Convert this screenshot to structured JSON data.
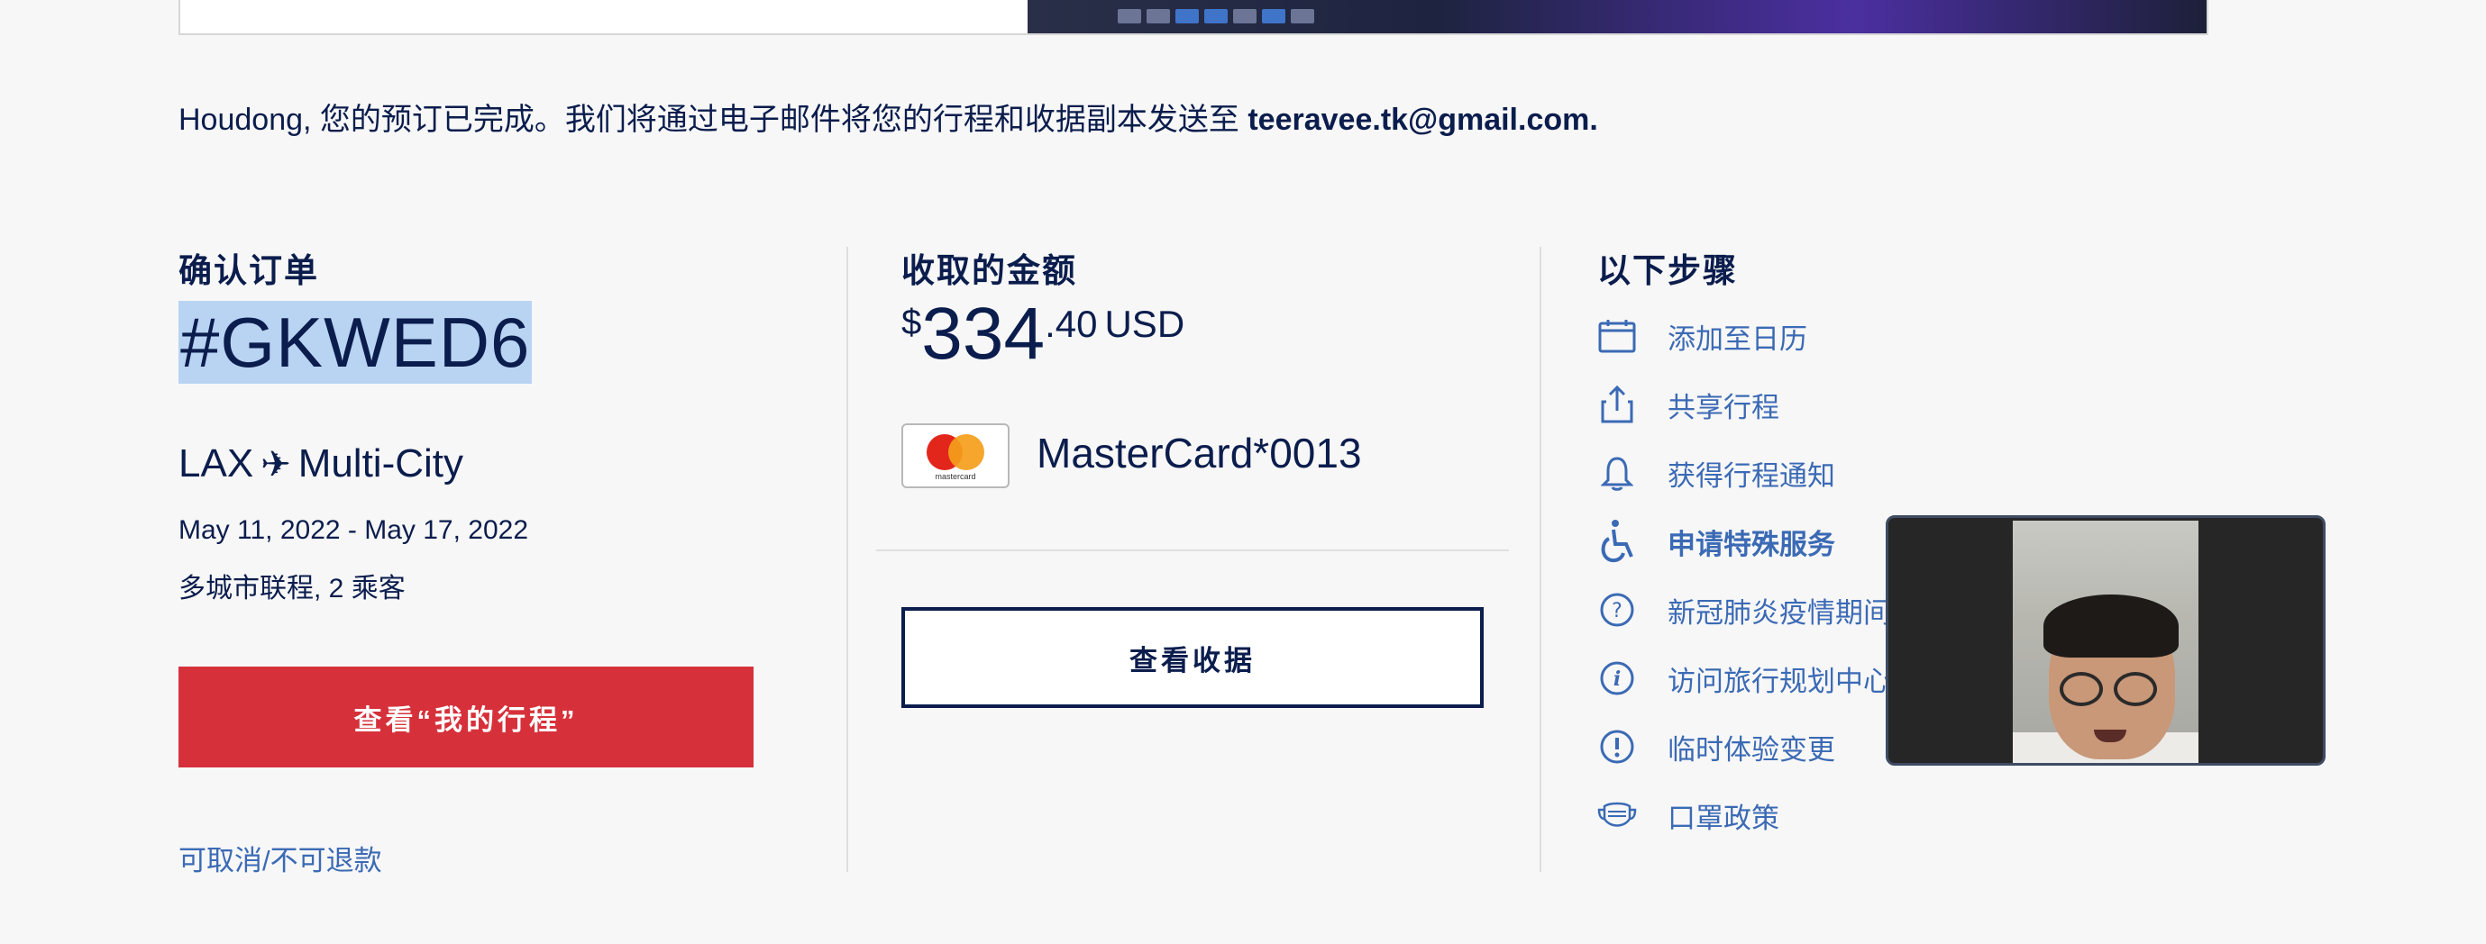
{
  "confirmation_message": {
    "text": "Houdong, 您的预订已完成。我们将通过电子邮件将您的行程和收据副本发送至 ",
    "email": "teeravee.tk@gmail.com."
  },
  "booking": {
    "title": "确认订单",
    "code": "#GKWED6",
    "origin": "LAX",
    "plane_glyph": "✈",
    "destination": "Multi-City",
    "dates": "May 11, 2022 - May 17, 2022",
    "trip_type": "多城市联程, 2 乘客",
    "view_trips_label": "查看“我的行程”",
    "cancel_link": "可取消/不可退款"
  },
  "payment": {
    "title": "收取的金额",
    "currency_symbol": "$",
    "amount_whole": "334",
    "amount_cents": ".40",
    "currency_code": "USD",
    "card_brand_text": "mastercard",
    "card_number": "MasterCard*0013",
    "view_receipt_label": "查看收据"
  },
  "next_steps": {
    "title": "以下步骤",
    "items": [
      {
        "label": "添加至日历",
        "icon": "calendar-icon"
      },
      {
        "label": "共享行程",
        "icon": "share-icon"
      },
      {
        "label": "获得行程通知",
        "icon": "bell-icon"
      },
      {
        "label": "申请特殊服务",
        "icon": "accessibility-icon"
      },
      {
        "label": "新冠肺炎疫情期间",
        "icon": "question-icon"
      },
      {
        "label": "访问旅行规划中心",
        "icon": "info-icon"
      },
      {
        "label": "临时体验变更",
        "icon": "alert-icon"
      },
      {
        "label": "口罩政策",
        "icon": "mask-icon"
      }
    ]
  },
  "colors": {
    "navy": "#0b1d4d",
    "link_blue": "#3b6ab5",
    "red_button": "#d6313b",
    "background": "#f7f7f7",
    "highlight": "#b9d4f3"
  }
}
